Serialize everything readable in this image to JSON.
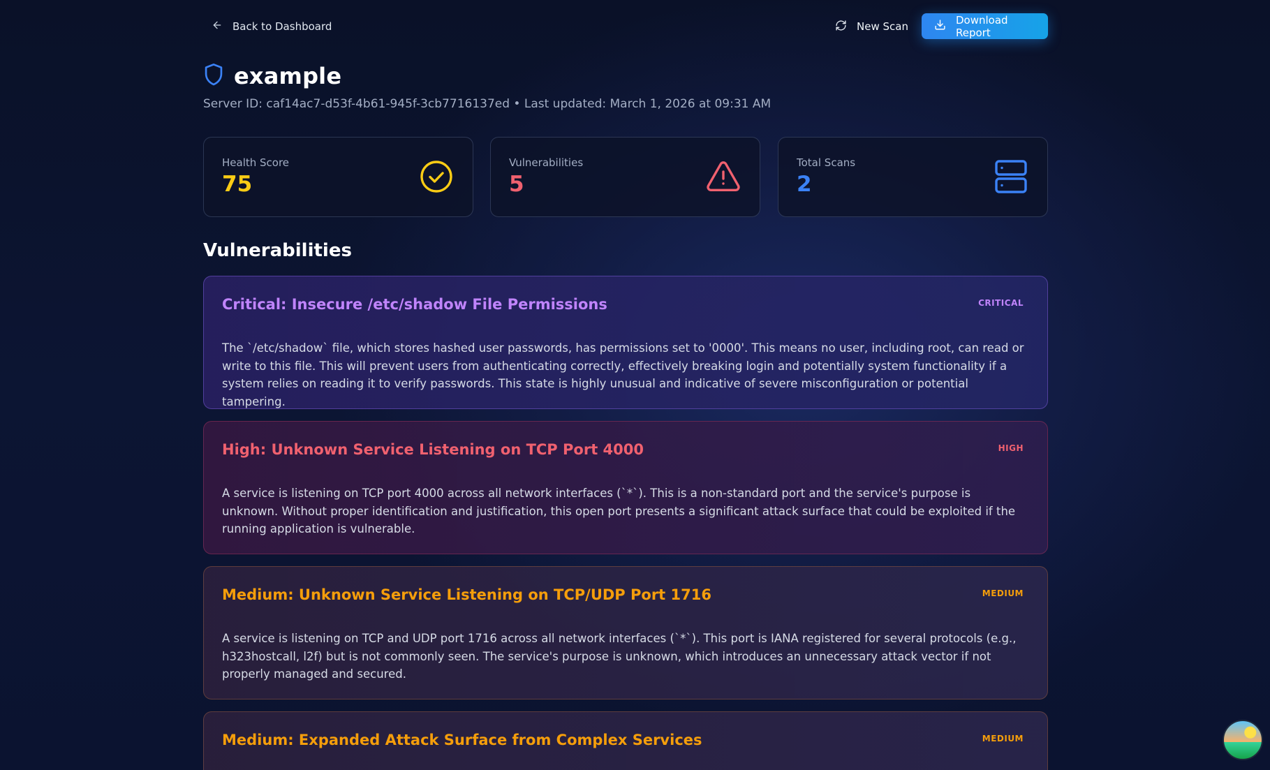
{
  "topbar": {
    "back_label": "Back to Dashboard",
    "new_scan_label": "New Scan",
    "download_label": "Download Report"
  },
  "server": {
    "name": "example",
    "subtitle": "Server ID: caf14ac7-d53f-4b61-945f-3cb7716137ed • Last updated: March 1, 2026 at 09:31 AM"
  },
  "stats": {
    "health": {
      "label": "Health Score",
      "value": "75",
      "color": "#facc15",
      "icon": "check-circle-icon"
    },
    "vulnerabilities": {
      "label": "Vulnerabilities",
      "value": "5",
      "color": "#f0616f",
      "icon": "warning-triangle-icon"
    },
    "scans": {
      "label": "Total Scans",
      "value": "2",
      "color": "#3b82f6",
      "icon": "server-icon"
    }
  },
  "section_title": "Vulnerabilities",
  "vulnerabilities": [
    {
      "title": "Critical: Insecure /etc/shadow File Permissions",
      "severity": "CRITICAL",
      "description": "The `/etc/shadow` file, which stores hashed user passwords, has permissions set to '0000'. This means no user, including root, can read or write to this file. This will prevent users from authenticating correctly, effectively breaking login and potentially system functionality if a system relies on reading it to verify passwords. This state is highly unusual and indicative of severe misconfiguration or potential tampering."
    },
    {
      "title": "High: Unknown Service Listening on TCP Port 4000",
      "severity": "HIGH",
      "description": "A service is listening on TCP port 4000 across all network interfaces (`*`). This is a non-standard port and the service's purpose is unknown. Without proper identification and justification, this open port presents a significant attack surface that could be exploited if the running application is vulnerable."
    },
    {
      "title": "Medium: Unknown Service Listening on TCP/UDP Port 1716",
      "severity": "MEDIUM",
      "description": "A service is listening on TCP and UDP port 1716 across all network interfaces (`*`). This port is IANA registered for several protocols (e.g., h323hostcall, l2f) but is not commonly seen. The service's purpose is unknown, which introduces an unnecessary attack vector if not properly managed and secured."
    },
    {
      "title": "Medium: Expanded Attack Surface from Complex Services",
      "severity": "MEDIUM",
      "description": ""
    }
  ]
}
